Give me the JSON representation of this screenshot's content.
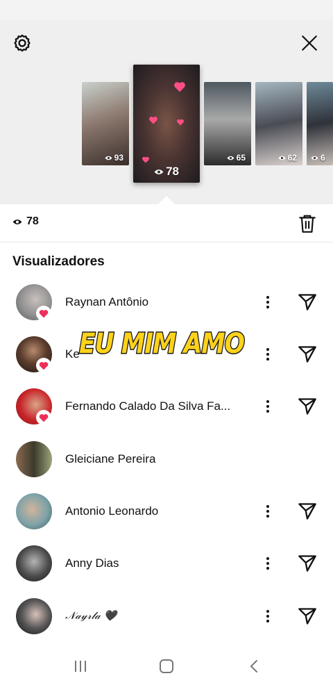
{
  "story_views": {
    "thumbnails": [
      {
        "count": "93",
        "colors": [
          "#b9c4bf",
          "#6b5a52",
          "#2c2422"
        ]
      },
      {
        "count": "78",
        "colors": [
          "#3a3638",
          "#6e4a3e",
          "#1c1a1c"
        ],
        "selected": true
      },
      {
        "count": "65",
        "colors": [
          "#5e6a72",
          "#c8c8c8",
          "#222"
        ]
      },
      {
        "count": "62",
        "colors": [
          "#9fb0ba",
          "#3a3c44",
          "#d8d0cc"
        ]
      },
      {
        "count": "6",
        "colors": [
          "#6c8797",
          "#2a2c34",
          "#c7bdb6"
        ]
      }
    ]
  },
  "viewbar": {
    "count": "78"
  },
  "section_title": "Visualizadores",
  "viewers": [
    {
      "name": "Raynan Antônio",
      "liked": true,
      "actions": true,
      "color": "#8f8f8f"
    },
    {
      "name": "Ke",
      "liked": true,
      "actions": true,
      "color": "#3d2a22"
    },
    {
      "name": "Fernando Calado Da Silva Fa...",
      "liked": true,
      "actions": true,
      "color": "#c8252a"
    },
    {
      "name": "Gleiciane Pereira",
      "liked": false,
      "actions": false,
      "color": "#6b7250"
    },
    {
      "name": "Antonio Leonardo",
      "liked": false,
      "actions": true,
      "color": "#7da2a8"
    },
    {
      "name": "Anny Dias",
      "liked": false,
      "actions": true,
      "color": "#3b3b3b"
    },
    {
      "name": "𝒩𝒶𝓎𝓇𝓁𝒶 🖤",
      "liked": false,
      "actions": true,
      "color": "#1c1c1c",
      "script": true
    }
  ],
  "sticker_text": "EU MIM AMO",
  "colors": {
    "heart": "#ee2f5a",
    "panel": "#efefef"
  },
  "icons": {
    "settings": "gear-icon",
    "close": "close-icon",
    "delete": "trash-icon",
    "more": "more-vertical-icon",
    "send": "send-icon",
    "eye": "eye-icon"
  }
}
